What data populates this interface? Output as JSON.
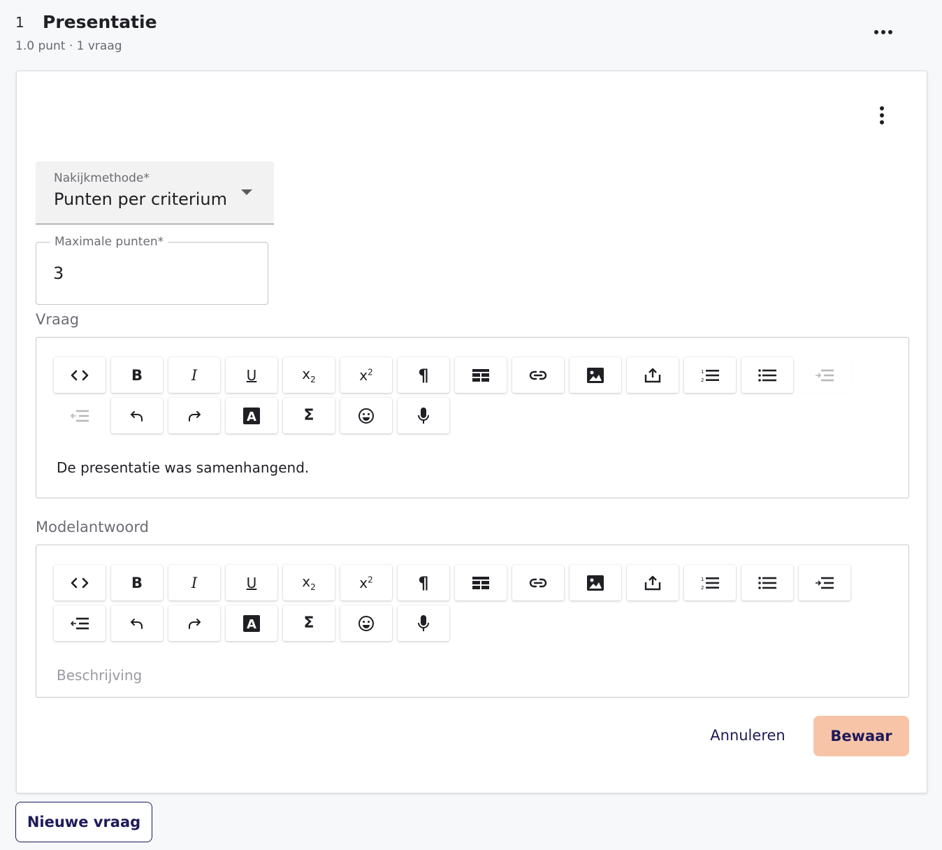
{
  "section": {
    "index": "1",
    "title": "Presentatie",
    "meta": "1.0 punt · 1 vraag",
    "more_icon": "more-horizontal-icon"
  },
  "card": {
    "more_icon": "more-vertical-icon"
  },
  "grading": {
    "label": "Nakijkmethode*",
    "value": "Punten per criterium"
  },
  "max_points": {
    "label": "Maximale punten*",
    "value": "3"
  },
  "question": {
    "label": "Vraag",
    "content": "De presentatie was samenhangend."
  },
  "model_answer": {
    "label": "Modelantwoord",
    "placeholder": "Beschrijving"
  },
  "toolbar": {
    "buttons": [
      {
        "name": "source-code",
        "icon": "code-icon",
        "glyph": "<>"
      },
      {
        "name": "bold",
        "icon": "bold-icon",
        "glyph": "B"
      },
      {
        "name": "italic",
        "icon": "italic-icon",
        "glyph": "I"
      },
      {
        "name": "underline",
        "icon": "underline-icon",
        "glyph": "U"
      },
      {
        "name": "subscript",
        "icon": "subscript-icon",
        "glyph": "x",
        "script": "2"
      },
      {
        "name": "superscript",
        "icon": "superscript-icon",
        "glyph": "x",
        "script": "2"
      },
      {
        "name": "paragraph",
        "icon": "pilcrow-icon",
        "glyph": "¶"
      },
      {
        "name": "table",
        "icon": "table-icon"
      },
      {
        "name": "link",
        "icon": "link-icon"
      },
      {
        "name": "image",
        "icon": "image-icon"
      },
      {
        "name": "upload",
        "icon": "upload-icon"
      },
      {
        "name": "numbered-list",
        "icon": "numbered-list-icon"
      },
      {
        "name": "bullet-list",
        "icon": "bullet-list-icon"
      },
      {
        "name": "indent",
        "icon": "indent-icon"
      },
      {
        "name": "outdent",
        "icon": "outdent-icon"
      },
      {
        "name": "undo",
        "icon": "undo-icon"
      },
      {
        "name": "redo",
        "icon": "redo-icon"
      },
      {
        "name": "text-color",
        "icon": "text-color-icon",
        "glyph": "A"
      },
      {
        "name": "formula",
        "icon": "sigma-icon",
        "glyph": "Σ"
      },
      {
        "name": "emoji",
        "icon": "emoji-icon"
      },
      {
        "name": "microphone",
        "icon": "microphone-icon"
      }
    ],
    "disabled_in_question": [
      "indent",
      "outdent"
    ]
  },
  "actions": {
    "cancel": "Annuleren",
    "save": "Bewaar"
  },
  "new_question": "Nieuwe vraag",
  "colors": {
    "accent": "#f8c4a8",
    "primary_text": "#1e1a5a"
  }
}
